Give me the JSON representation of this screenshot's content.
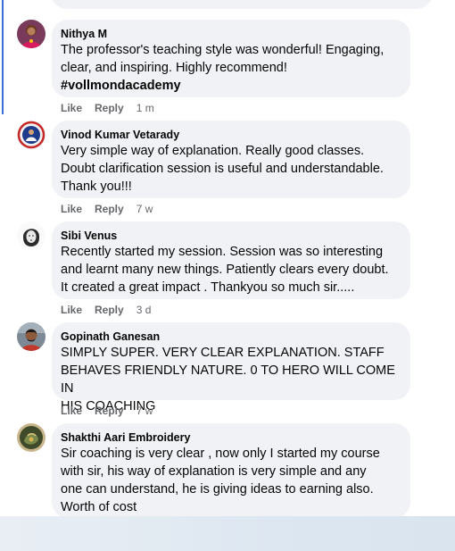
{
  "comments": [
    {
      "author": "Nithya M",
      "avatar_icon": "profile-photo-icon",
      "text": "The professor's teaching style was wonderful! Engaging,\nclear, and inspiring. Highly recommend!",
      "hashtag": "#vollmondacademy",
      "like": "Like",
      "reply": "Reply",
      "time": "1 m"
    },
    {
      "author": "Vinod Kumar Vetarady",
      "avatar_icon": "emblem-avatar-icon",
      "text": "Very simple way of explanation. Really good classes.\nDoubt clarification session is useful and understandable.\nThank you!!!",
      "like": "Like",
      "reply": "Reply",
      "time": "7 w"
    },
    {
      "author": "Sibi Venus",
      "avatar_icon": "sketch-avatar-icon",
      "text": "Recently started my session. Session was so interesting\nand learnt many new things. Patiently clears every doubt.\nIt created a great impact . Thankyou so much sir.....",
      "like": "Like",
      "reply": "Reply",
      "time": "3 d"
    },
    {
      "author": "Gopinath Ganesan",
      "avatar_icon": "profile-photo-icon",
      "text": "SIMPLY SUPER. VERY CLEAR EXPLANATION. STAFF\nBEHAVES FRIENDLY NATURE. 0 TO HERO WILL COME IN\nHIS COACHING",
      "like": "Like",
      "reply": "Reply",
      "time": "7 w"
    },
    {
      "author": "Shakthi Aari Embroidery",
      "avatar_icon": "embroidery-avatar-icon",
      "text": "Sir coaching is very clear , now only I started my course\nwith sir, his way of explanation is very simple and any\none can understand, he is giving ideas to earning also.\nWorth of cost"
    }
  ],
  "colors": {
    "bubble": "#f0f2f5",
    "meta": "#65676b",
    "thread_line": "#3b6fd8"
  }
}
